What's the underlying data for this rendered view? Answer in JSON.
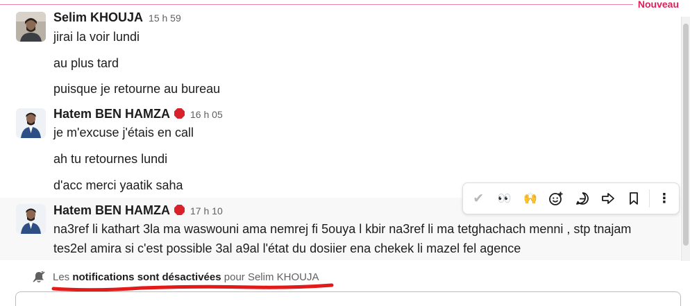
{
  "divider": {
    "label": "Nouveau"
  },
  "messages": [
    {
      "sender": "Selim KHOUJA",
      "time": "15 h 59",
      "lines": [
        "jirai la voir lundi",
        "au plus tard",
        "puisque je retourne au bureau"
      ]
    },
    {
      "sender": "Hatem BEN HAMZA",
      "time": "16 h 05",
      "lines": [
        "je m'excuse j'étais en call",
        "ah tu retournes lundi",
        "d'acc merci yaatik saha"
      ]
    },
    {
      "sender": "Hatem BEN HAMZA",
      "time": "17 h 10",
      "lines": [
        "na3ref li kathart 3la ma waswouni ama nemrej fi 5ouya l kbir na3ref li ma tetghachach menni , stp tnajam",
        "tes2el amira si c'est possible 3al a9al l'état du dosiier ena chekek li mazel fel agence"
      ]
    }
  ],
  "toolbar": {
    "check": "✔",
    "eyes": "👀",
    "hands": "🙌",
    "add_reaction": "☺",
    "reply": "⌕",
    "forward": "⇨",
    "bookmark": "🔖",
    "more": "⋮"
  },
  "notice": {
    "prefix": "Les",
    "bold": "notifications sont désactivées",
    "suffix": "pour Selim KHOUJA"
  },
  "colors": {
    "accent": "#e01e5a",
    "underline": "#e21a1a",
    "status": "#d9212c"
  }
}
